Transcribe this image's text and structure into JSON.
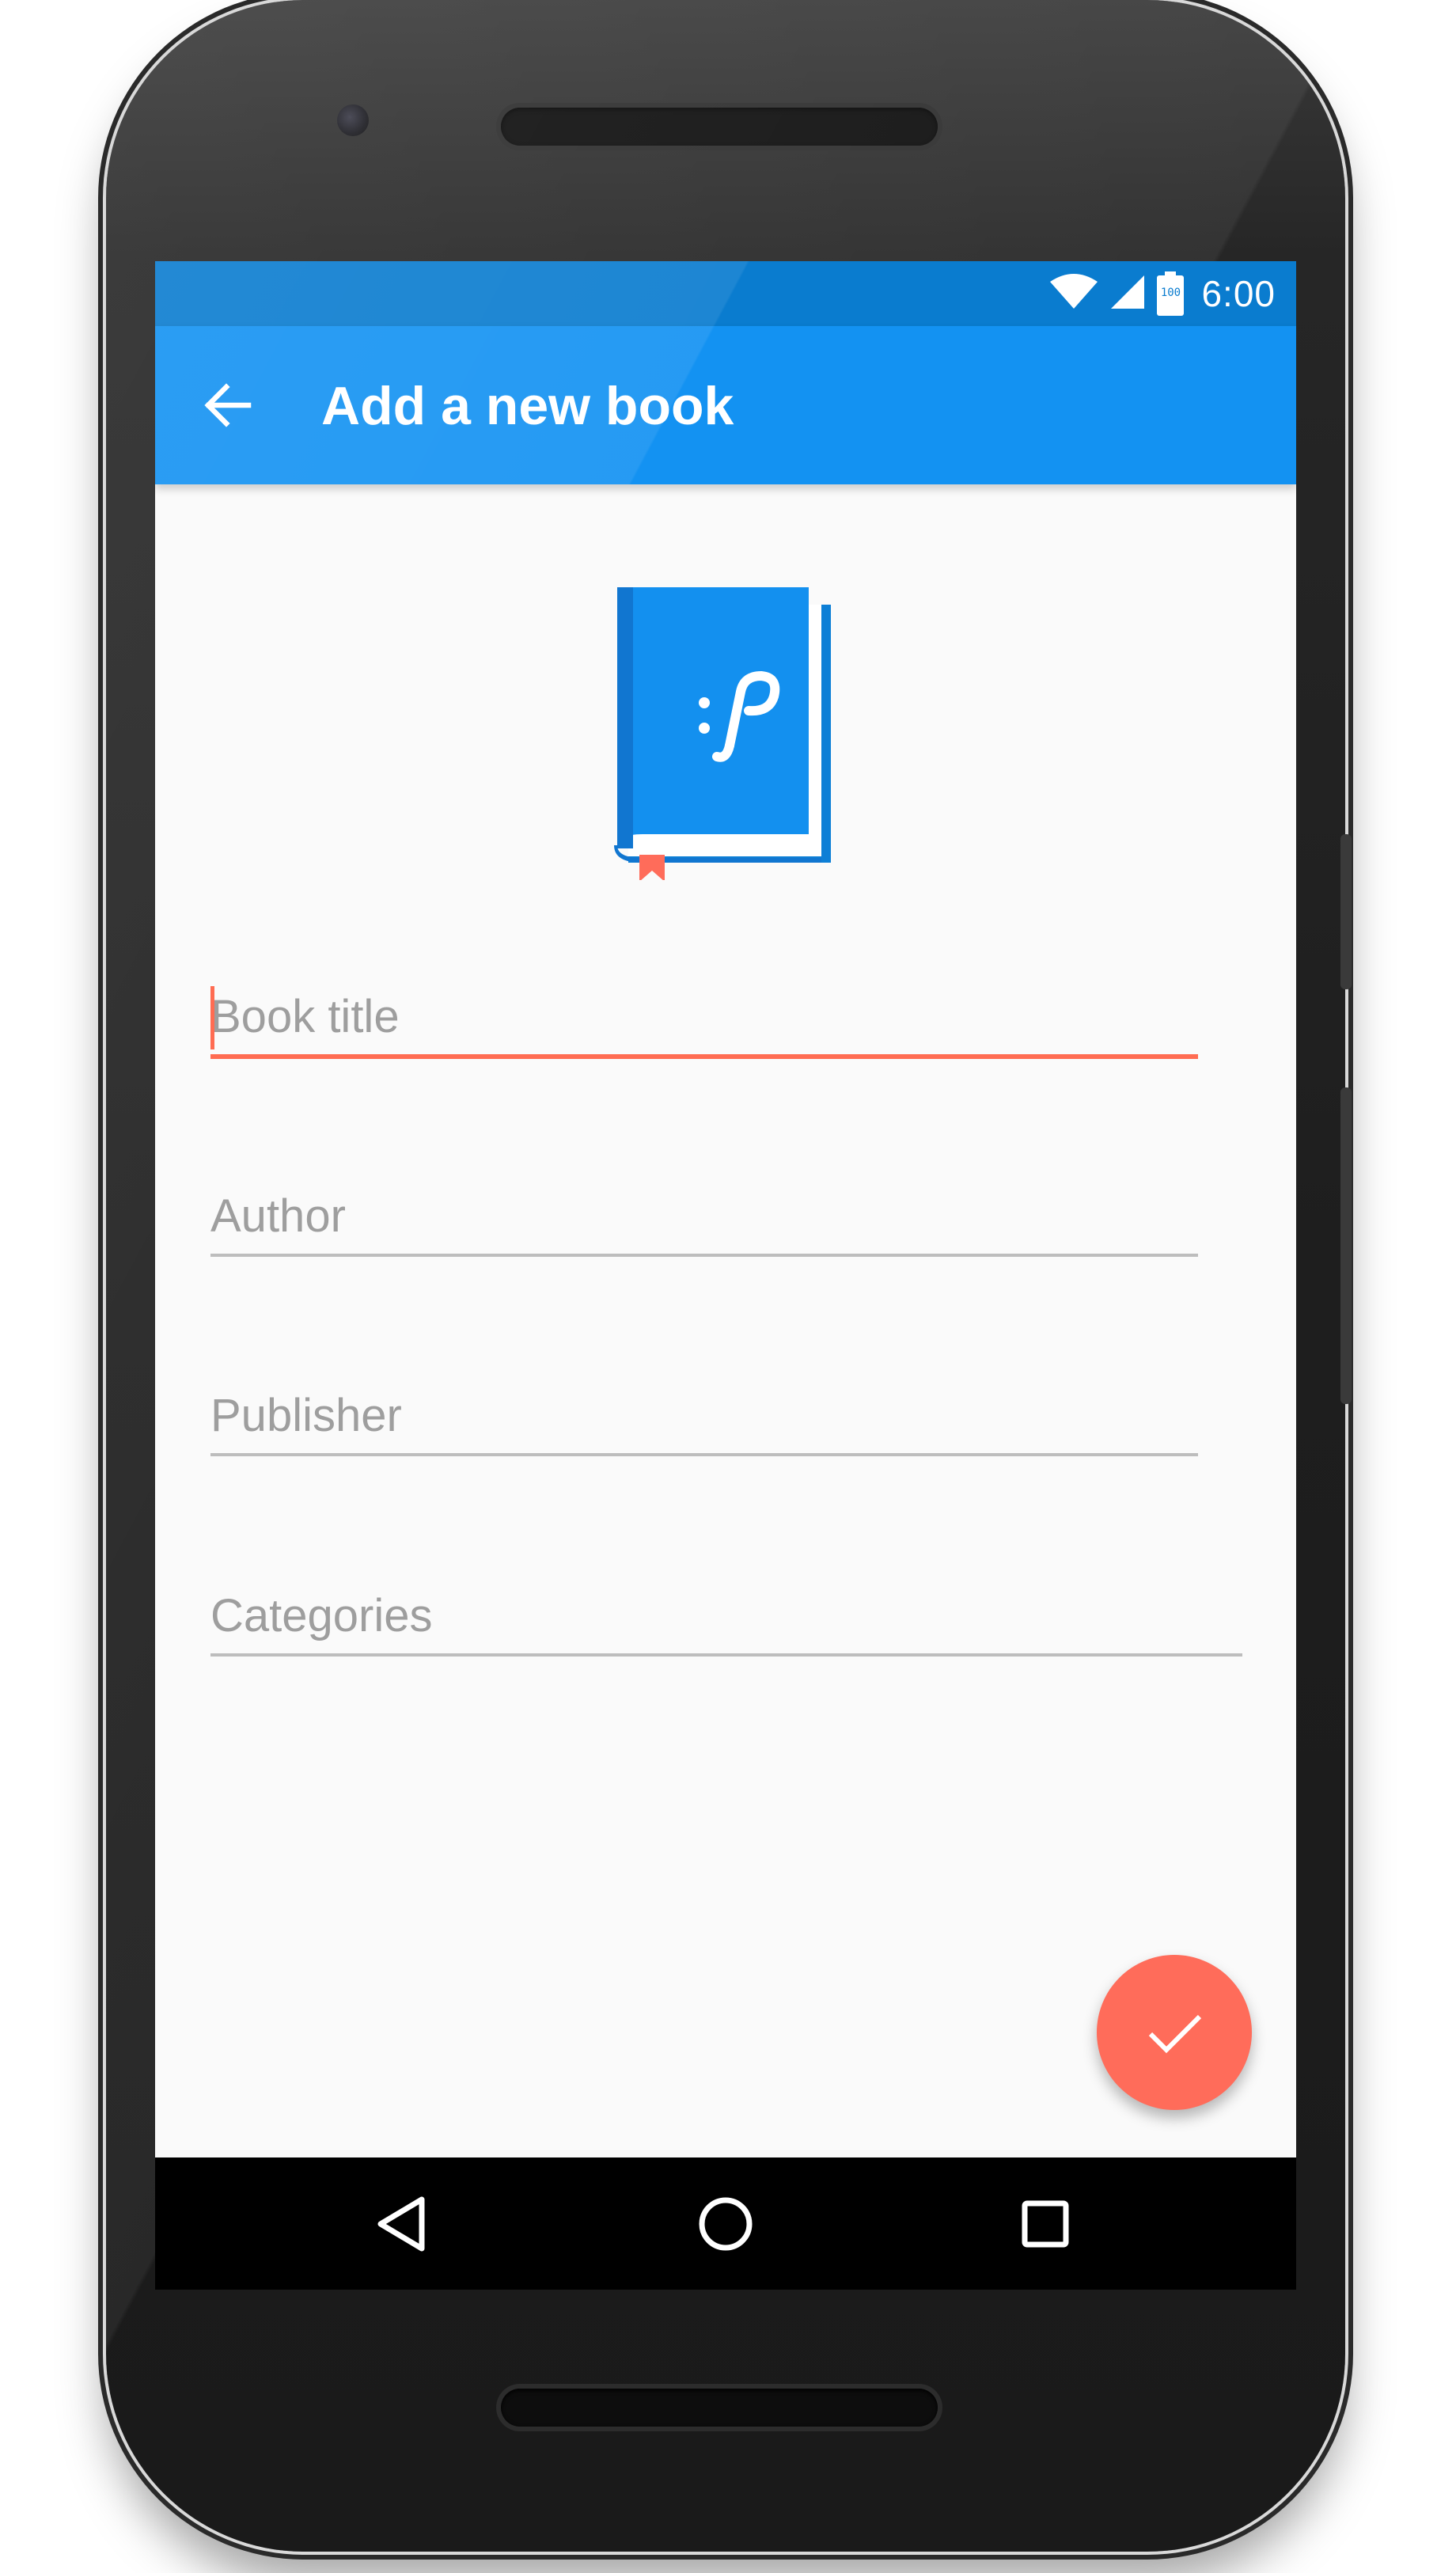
{
  "app": {
    "title": "Add a new book"
  },
  "status_bar": {
    "time": "6:00",
    "battery_level": "100",
    "icons": [
      "wifi-icon",
      "cellular-signal-icon",
      "battery-icon"
    ]
  },
  "form": {
    "fields": [
      {
        "name": "book-title",
        "placeholder": "Book title",
        "value": "",
        "focused": true
      },
      {
        "name": "author",
        "placeholder": "Author",
        "value": "",
        "focused": false
      },
      {
        "name": "publisher",
        "placeholder": "Publisher",
        "value": "",
        "focused": false
      },
      {
        "name": "categories",
        "placeholder": "Categories",
        "value": "",
        "focused": false
      }
    ]
  },
  "fab": {
    "icon": "check-icon"
  },
  "nav_bar": {
    "icons": [
      "nav-back-icon",
      "nav-home-icon",
      "nav-recents-icon"
    ]
  },
  "colors": {
    "status_bar": "#0a7ccf",
    "app_bar": "#1392f2",
    "accent": "#ff6c52",
    "background": "#fafafa",
    "placeholder": "#9e9e9e",
    "underline": "#bdbdbd",
    "book_blue": "#1390ef"
  }
}
